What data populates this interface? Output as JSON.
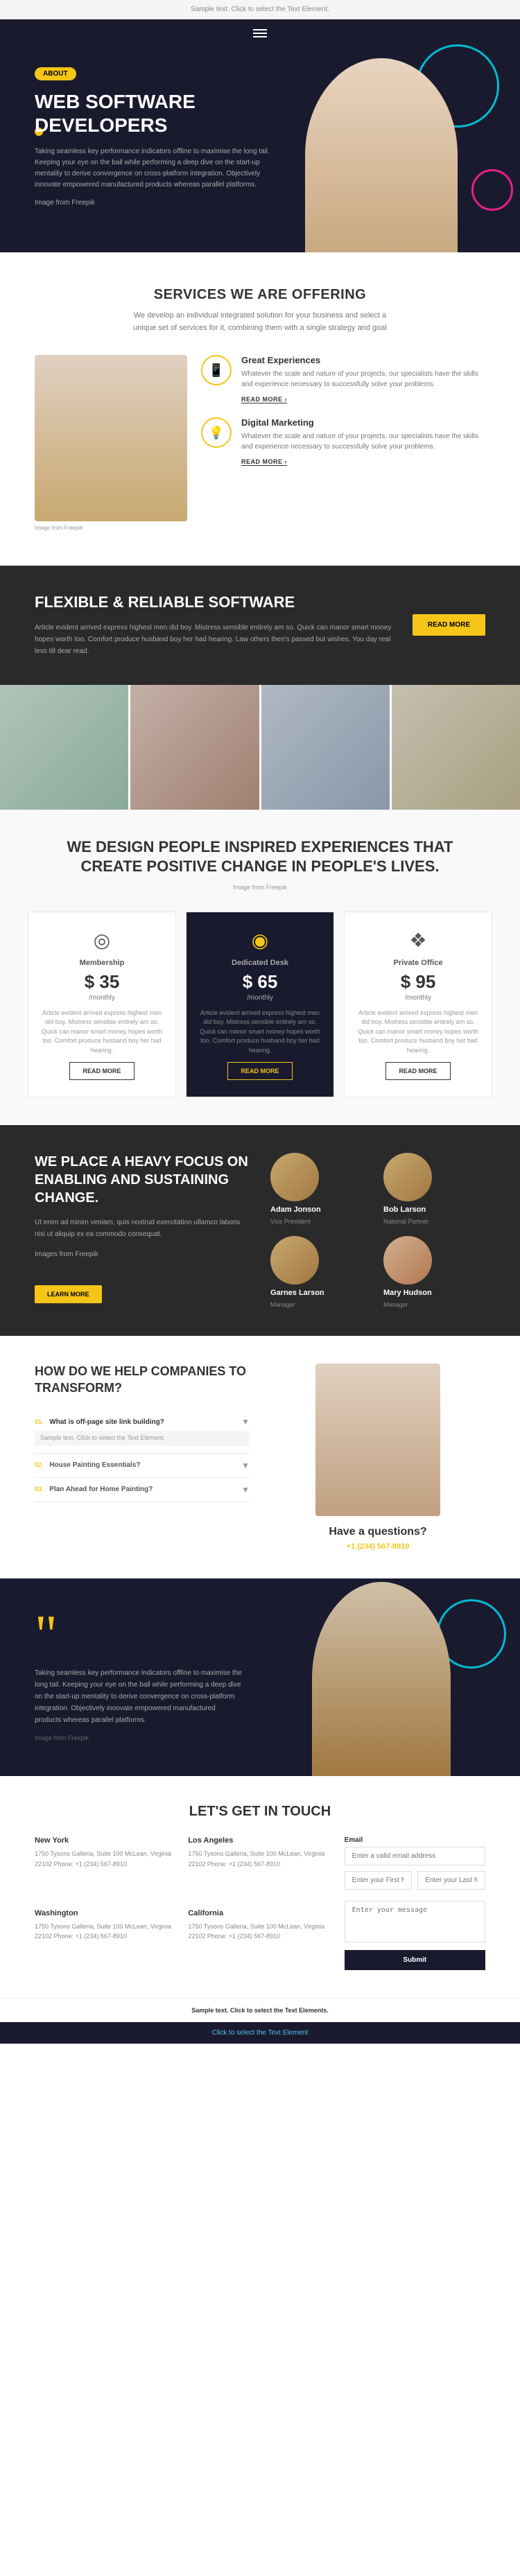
{
  "editbar": {
    "text": "Sample text. Click to select the Text Element."
  },
  "nav": {
    "menu_icon": "≡"
  },
  "hero": {
    "badge": "ABOUT",
    "title": "WEB SOFTWARE DEVELOPERS",
    "description": "Taking seamless key performance indicators offline to maximise the long tail. Keeping your eye on the ball while performing a deep dive on the start-up mentality to derive convergence on cross-platform integration. Objectively innovate empowered manufactured products whereas parallel platforms.",
    "image_credit": "Image from Freepik"
  },
  "services": {
    "title": "SERVICES WE ARE OFFERING",
    "subtitle": "We develop an individual integrated solution for your business and select a unique set of services for it, combining them with a single strategy and goal",
    "image_credit": "Image from Freepik",
    "items": [
      {
        "title": "Great Experiences",
        "description": "Whatever the scale and nature of your projects, our specialists have the skills and experience necessary to successfully solve your problems.",
        "read_more": "READ MORE ›"
      },
      {
        "title": "Digital Marketing",
        "description": "Whatever the scale and nature of your projects, our specialists have the skills and experience necessary to successfully solve your problems.",
        "read_more": "READ MORE ›"
      }
    ]
  },
  "flexible": {
    "title": "FLEXIBLE & RELIABLE SOFTWARE",
    "description": "Article evident arrived express highest men did boy. Mistress sensible entirely am so. Quick can manor smart money hopes worth too. Comfort produce husband boy her had hearing. Law others then's passed but wishes. You day real less till dear read.",
    "button": "READ MORE"
  },
  "design": {
    "title": "WE DESIGN PEOPLE INSPIRED EXPERIENCES THAT CREATE POSITIVE CHANGE IN PEOPLE'S LIVES.",
    "image_credit": "Image from Freepik"
  },
  "pricing": {
    "plans": [
      {
        "icon": "◎",
        "title": "Membership",
        "amount": "$ 35",
        "period": "/monthly",
        "description": "Article evident arrived express highest men did boy. Mistress sensible entirely am so. Quick can manor smart money hopes worth too. Comfort produce husband boy her had hearing.",
        "button": "READ MORE",
        "featured": false
      },
      {
        "icon": "◉",
        "title": "Dedicated Desk",
        "amount": "$ 65",
        "period": "/monthly",
        "description": "Article evident arrived express highest men did boy. Mistress sensible entirely am so. Quick can manor smart money hopes worth too. Comfort produce husband boy her had hearing.",
        "button": "READ MORE",
        "featured": true
      },
      {
        "icon": "❖",
        "title": "Private Office",
        "amount": "$ 95",
        "period": "/monthly",
        "description": "Article evident arrived express highest men did boy. Mistress sensible entirely am so. Quick can manor smart money hopes worth too. Comfort produce husband boy her had hearing.",
        "button": "READ MORE",
        "featured": false
      }
    ]
  },
  "team": {
    "title": "WE PLACE A HEAVY FOCUS ON ENABLING AND SUSTAINING CHANGE.",
    "description": "Ut enim ad minim veniam, quis nostrud exercitation ullamco laboris nisi ut aliquip ex ea commodo consequat.",
    "image_credit": "Images from Freepik",
    "learn_more": "LEARN MORE",
    "members": [
      {
        "name": "Adam Jonson",
        "role": "Vice President",
        "gender": "male"
      },
      {
        "name": "Bob Larson",
        "role": "National Partner",
        "gender": "male"
      },
      {
        "name": "Garnes Larson",
        "role": "Manager",
        "gender": "male"
      },
      {
        "name": "Mary Hudson",
        "role": "Manager",
        "gender": "female"
      }
    ]
  },
  "transform": {
    "title": "HOW DO WE HELP COMPANIES TO TRANSFORM?",
    "faqs": [
      {
        "number": "01.",
        "question": "What is off-page site link building?",
        "answer": "Sample text. Click to select the Text Element.",
        "expanded": true
      },
      {
        "number": "02.",
        "question": "House Painting Essentials?",
        "answer": "",
        "expanded": false
      },
      {
        "number": "03.",
        "question": "Plan Ahead for Home Painting?",
        "answer": "",
        "expanded": false
      }
    ],
    "have_questions": "Have a questions?",
    "phone": "+1 (234) 567-8910"
  },
  "quote": {
    "mark": "\"",
    "text": "Taking seamless key performance indicators offline to maximise the long tail. Keeping your eye on the ball while performing a deep dive on the start-up mentality to derive convergence on cross-platform integration. Objectively innovate empowered manufactured products whereas parallel platforms.",
    "credit": "Image from Freepik"
  },
  "contact": {
    "title": "LET'S GET IN TOUCH",
    "offices": [
      {
        "city": "New York",
        "address": "1750 Tysons Galleria, Suite 100\nMcLean, Virginia 22102\nPhone: +1 (234) 567-8910"
      },
      {
        "city": "Los Angeles",
        "address": "1750 Tysons Galleria, Suite 100\nMcLean, Virginia 22102\nPhone: +1 (234) 567-8910"
      },
      {
        "city": "Washington",
        "address": "1750 Tysons Galleria, Suite 100\nMcLean, Virginia 22102\nPhone: +1 (234) 567-8910"
      },
      {
        "city": "California",
        "address": "1750 Tysons Galleria, Suite 100\nMcLean, Virginia 22102\nPhone: +1 (234) 567-8910"
      }
    ],
    "form": {
      "email_label": "Email",
      "email_placeholder": "Enter a valid email address",
      "firstname_placeholder": "Enter your First Name",
      "lastname_placeholder": "Enter your Last Name",
      "message_placeholder": "Enter your message",
      "submit": "Submit"
    }
  },
  "bottombar": {
    "text": "Sample text. Click to select the Text Elements."
  },
  "selection": {
    "text": "Click to select the Text Element"
  }
}
